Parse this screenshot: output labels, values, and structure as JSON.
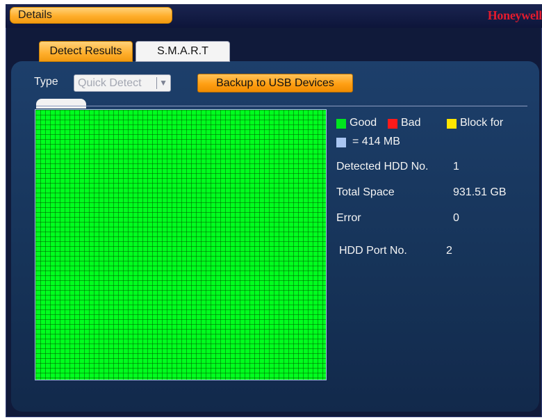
{
  "title_bar": {
    "details_label": "Details",
    "brand": "Honeywell"
  },
  "tabs": [
    {
      "label": "Detect Results",
      "active": true
    },
    {
      "label": "S.M.A.R.T",
      "active": false
    }
  ],
  "toolbar": {
    "type_label": "Type",
    "type_select_value": "Quick Detect",
    "backup_button_label": "Backup to USB Devices"
  },
  "legend": {
    "good_label": "Good",
    "bad_label": "Bad",
    "block_label": "Block for",
    "block_size_label": "= 414 MB",
    "colors": {
      "good": "#00e61e",
      "bad": "#ff1a1a",
      "block": "#ffe600",
      "unit": "#a9c6f2"
    }
  },
  "detect_info": {
    "hdd_no_label": "Detected HDD No.",
    "hdd_no_value": "1",
    "total_space_label": "Total Space",
    "total_space_value": "931.51 GB",
    "error_label": "Error",
    "error_value": "0",
    "hdd_port_label": "HDD Port No.",
    "hdd_port_value": "2"
  },
  "grid_status": "good",
  "accent_colors": {
    "orange": "#ffae2c",
    "panel": "#1d3f6b",
    "brand": "#e21b2e"
  }
}
